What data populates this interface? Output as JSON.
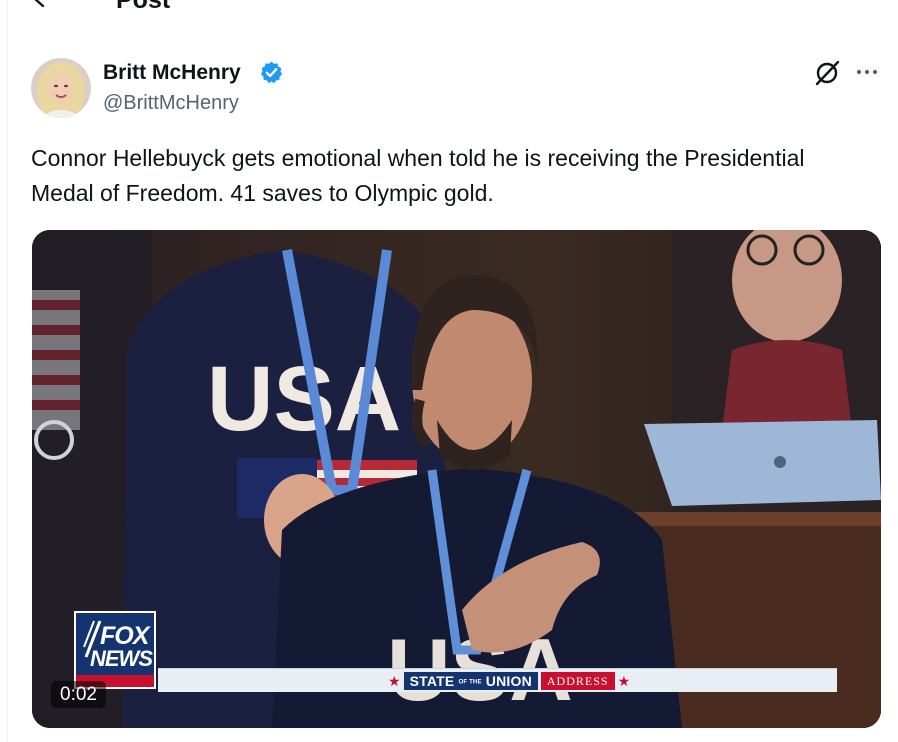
{
  "header": {
    "title": "Post"
  },
  "author": {
    "display_name": "Britt McHenry",
    "handle": "@BrittMcHenry",
    "verified_color": "#1d9bf0"
  },
  "tweet": {
    "text": "Connor Hellebuyck gets emotional when told he is receiving the Presidential Medal of Freedom. 41 saves to Olympic gold."
  },
  "media": {
    "type": "video",
    "duration": "0:02",
    "logo_line1": "FOX",
    "logo_line2": "NEWS",
    "banner_left": "STATE",
    "banner_small": "OF THE",
    "banner_union": "UNION",
    "banner_right": "ADDRESS",
    "sweater_text": "USA"
  },
  "icons": {
    "back": "arrow-left-icon",
    "verified": "verified-badge-icon",
    "grok": "grok-icon",
    "more": "more-horizontal-icon"
  }
}
